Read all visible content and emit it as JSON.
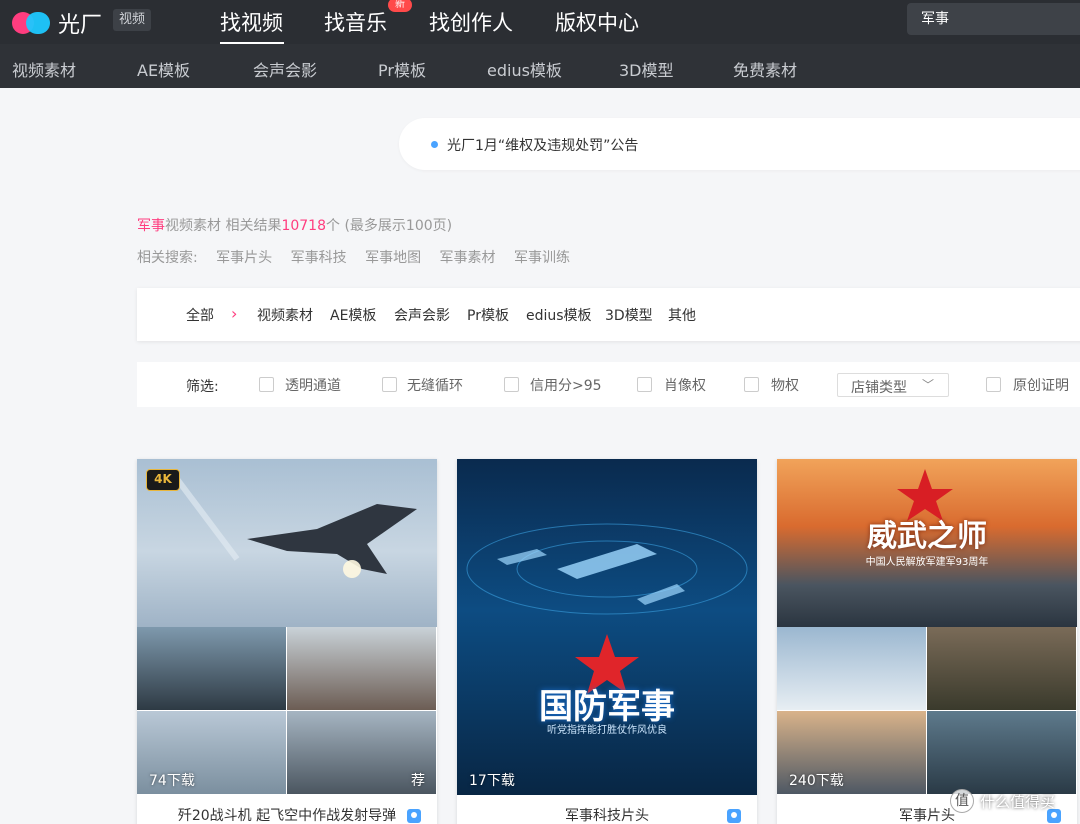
{
  "header": {
    "brand": "光厂",
    "brand_tag": "视频",
    "nav": [
      "找视频",
      "找音乐",
      "找创作人",
      "版权中心"
    ],
    "new_badge": "新",
    "search_value": "军事"
  },
  "subnav": [
    "视频素材",
    "AE模板",
    "会声会影",
    "Pr模板",
    "edius模板",
    "3D模型",
    "免费素材"
  ],
  "notice": "光厂1月“维权及违规处罚”公告",
  "results": {
    "keyword": "军事",
    "prefix": "视频素材 相关结果",
    "count": "10718",
    "suffix": "个 (最多展示100页)"
  },
  "related": {
    "label": "相关搜索:",
    "items": [
      "军事片头",
      "军事科技",
      "军事地图",
      "军事素材",
      "军事训练"
    ]
  },
  "categories": {
    "all": "全部",
    "items": [
      "视频素材",
      "AE模板",
      "会声会影",
      "Pr模板",
      "edius模板",
      "3D模型",
      "其他"
    ]
  },
  "filters": {
    "label": "筛选:",
    "options": [
      "透明通道",
      "无缝循环",
      "信用分>95",
      "肖像权",
      "物权"
    ],
    "select": "店铺类型",
    "last": "原创证明"
  },
  "cards": [
    {
      "badge": "4K",
      "downloads": "74下载",
      "fav": "荐",
      "title": "歼20战斗机 起飞空中作战发射导弹"
    },
    {
      "downloads": "17下载",
      "title": "军事科技片头",
      "overlay": "国防军事",
      "overlay_sub": "听党指挥能打胜仗作风优良"
    },
    {
      "downloads": "240下载",
      "title": "军事片头",
      "overlay": "威武之师",
      "overlay_sub": "中国人民解放军建军93周年"
    }
  ],
  "watermark": "什么值得买",
  "colors": {
    "accent": "#ff3d7f",
    "topbar": "#2b2e33",
    "badge4k": "#e9b63b"
  }
}
